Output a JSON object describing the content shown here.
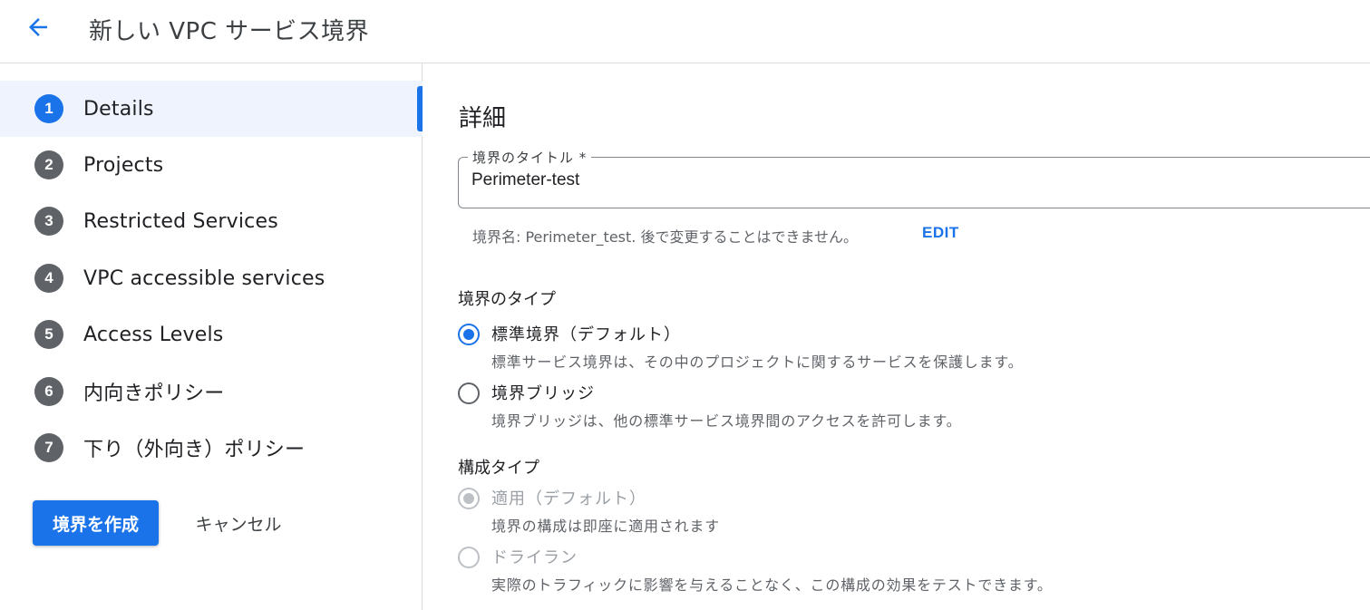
{
  "header": {
    "title": "新しい VPC サービス境界"
  },
  "sidebar": {
    "steps": [
      {
        "number": "1",
        "label": "Details",
        "active": true
      },
      {
        "number": "2",
        "label": "Projects"
      },
      {
        "number": "3",
        "label": "Restricted Services"
      },
      {
        "number": "4",
        "label": "VPC accessible services"
      },
      {
        "number": "5",
        "label": "Access Levels"
      },
      {
        "number": "6",
        "label": "内向きポリシー"
      },
      {
        "number": "7",
        "label": "下り（外向き）ポリシー"
      }
    ],
    "create_label": "境界を作成",
    "cancel_label": "キャンセル"
  },
  "main": {
    "section_title": "詳細",
    "title_field": {
      "label": "境界のタイトル *",
      "value": "Perimeter-test"
    },
    "hint": "境界名: Perimeter_test. 後で変更することはできません。",
    "edit_label": "EDIT",
    "perimeter_type": {
      "title": "境界のタイプ",
      "options": [
        {
          "label": "標準境界（デフォルト）",
          "description": "標準サービス境界は、その中のプロジェクトに関するサービスを保護します。",
          "checked": true
        },
        {
          "label": "境界ブリッジ",
          "description": "境界ブリッジは、他の標準サービス境界間のアクセスを許可します。",
          "checked": false
        }
      ]
    },
    "config_type": {
      "title": "構成タイプ",
      "options": [
        {
          "label": "適用（デフォルト）",
          "description": "境界の構成は即座に適用されます",
          "checked": true,
          "disabled": true
        },
        {
          "label": "ドライラン",
          "description": "実際のトラフィックに影響を与えることなく、この構成の効果をテストできます。",
          "checked": false,
          "disabled": true
        }
      ]
    }
  },
  "colors": {
    "accent": "#1a73e8",
    "step_inactive": "#5f6368",
    "active_bg": "#eef3fd"
  }
}
